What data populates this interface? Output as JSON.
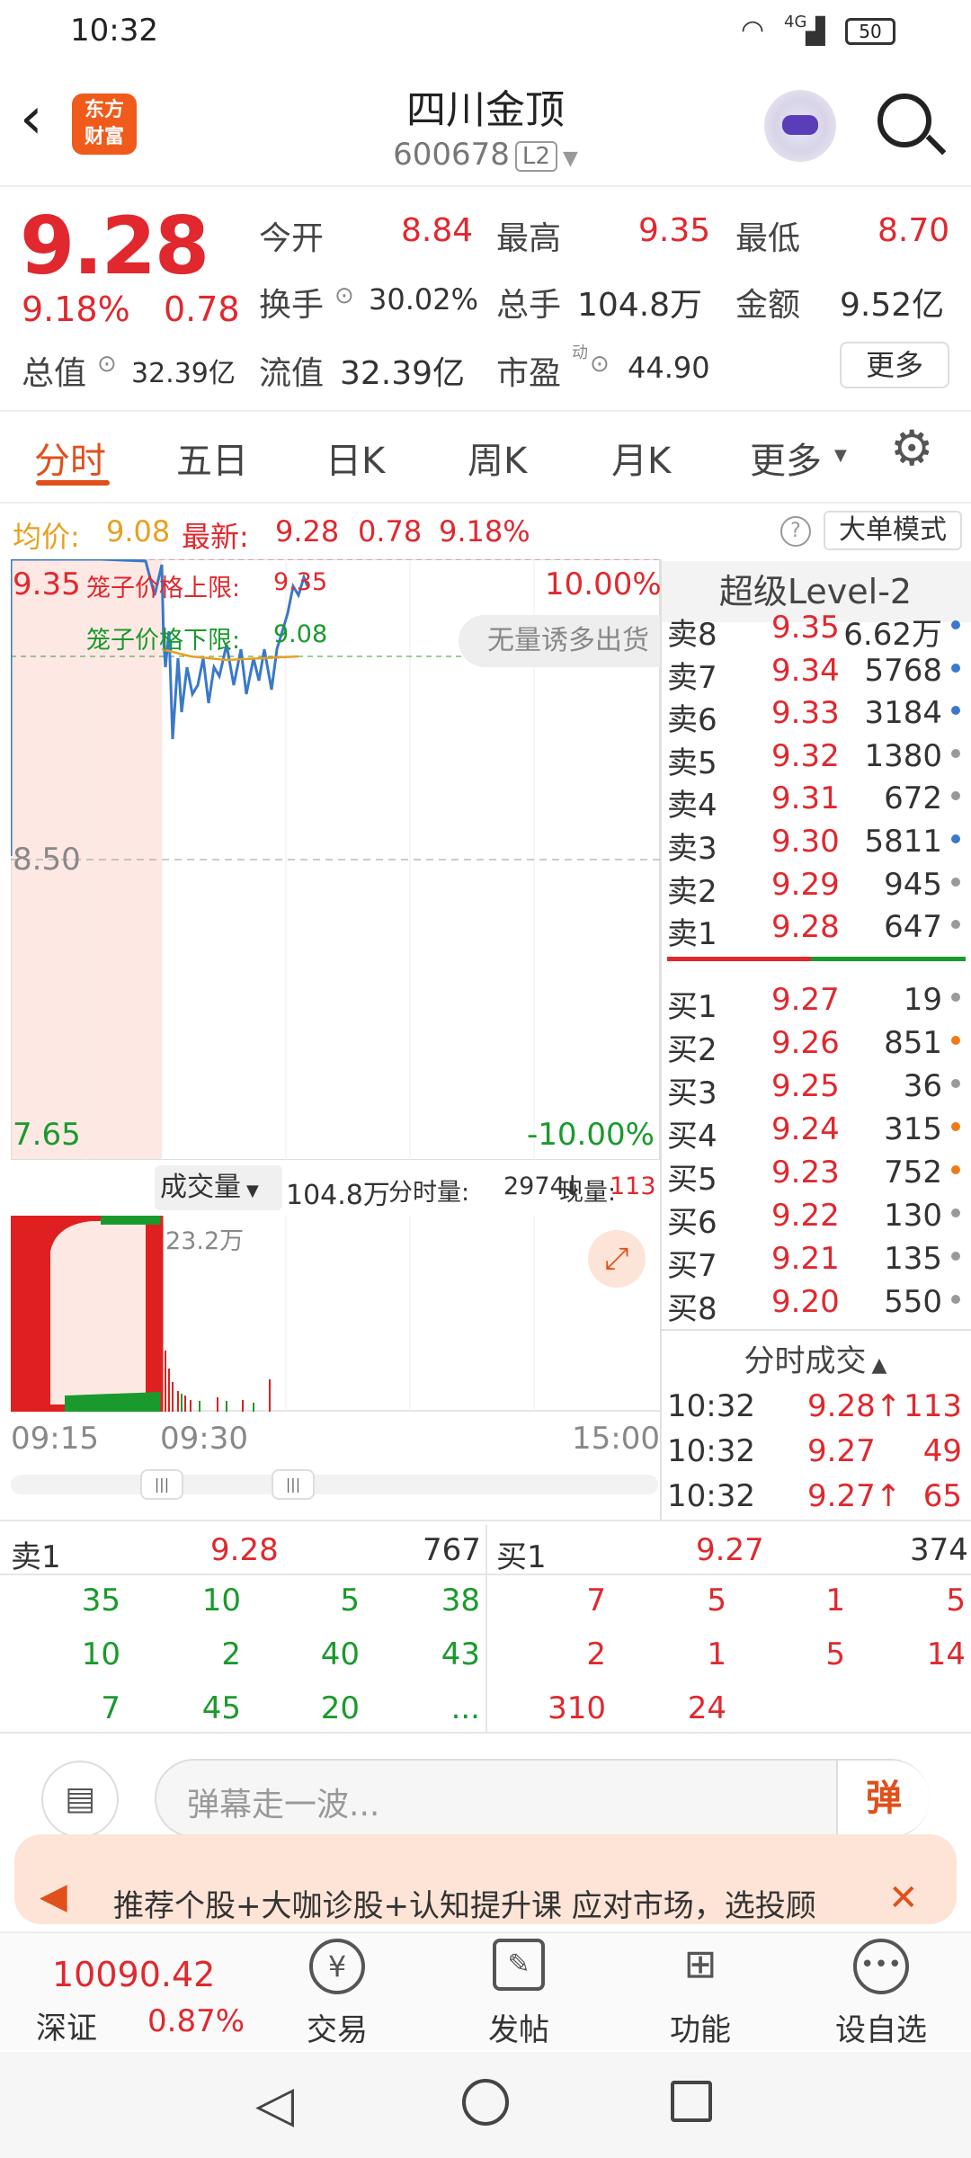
{
  "status_bar": {
    "time": "10:32",
    "signal": "4G",
    "battery": "50"
  },
  "header": {
    "logo_text_line1": "东方",
    "logo_text_line2": "财富",
    "title": "四川金顶",
    "code": "600678",
    "level_badge": "L2"
  },
  "quote": {
    "price": "9.28",
    "change_pct": "9.18%",
    "change": "0.78",
    "open_label": "今开",
    "open": "8.84",
    "high_label": "最高",
    "high": "9.35",
    "low_label": "最低",
    "low": "8.70",
    "turnover_label": "换手",
    "turnover": "30.02%",
    "volume_label": "总手",
    "volume": "104.8万",
    "amount_label": "金额",
    "amount": "9.52亿",
    "mktcap_label": "总值",
    "mktcap": "32.39亿",
    "float_label": "流值",
    "float": "32.39亿",
    "pe_label": "市盈",
    "pe_sup": "动",
    "pe": "44.90",
    "more_button": "更多"
  },
  "tabs": [
    {
      "label": "分时",
      "active": true
    },
    {
      "label": "五日"
    },
    {
      "label": "日K"
    },
    {
      "label": "周K"
    },
    {
      "label": "月K"
    },
    {
      "label": "更多"
    }
  ],
  "info_bar": {
    "avg_label": "均价:",
    "avg": "9.08",
    "latest_label": "最新:",
    "latest": "9.28",
    "latest_change": "0.78",
    "latest_pct": "9.18%",
    "big_order_mode": "大单模式"
  },
  "intraday_chart": {
    "y_top": "9.35",
    "y_mid": "8.50",
    "y_bottom": "7.65",
    "pct_top": "10.00%",
    "pct_bottom": "-10.00%",
    "cage_upper_label": "笼子价格上限:",
    "cage_upper": "9.35",
    "cage_lower_label": "笼子价格下限:",
    "cage_lower": "9.08",
    "toast": "无量诱多出货"
  },
  "volume_bar": {
    "label": "成交量",
    "total": "104.8万",
    "minute_label": "分时量:",
    "minute": "2974",
    "current_label": "现量:",
    "current": "113",
    "max_vol": "23.2万",
    "time_start": "09:15",
    "time_open": "09:30",
    "time_end": "15:00"
  },
  "level2_title": "超级Level-2",
  "order_book": {
    "asks": [
      {
        "label": "卖8",
        "price": "9.35",
        "vol": "6.62万",
        "dot": "#3a78c9"
      },
      {
        "label": "卖7",
        "price": "9.34",
        "vol": "5768",
        "dot": "#3a78c9"
      },
      {
        "label": "卖6",
        "price": "9.33",
        "vol": "3184",
        "dot": "#3a78c9"
      },
      {
        "label": "卖5",
        "price": "9.32",
        "vol": "1380",
        "dot": "#999999"
      },
      {
        "label": "卖4",
        "price": "9.31",
        "vol": "672",
        "dot": "#999999"
      },
      {
        "label": "卖3",
        "price": "9.30",
        "vol": "5811",
        "dot": "#3a78c9"
      },
      {
        "label": "卖2",
        "price": "9.29",
        "vol": "945",
        "dot": "#999999"
      },
      {
        "label": "卖1",
        "price": "9.28",
        "vol": "647",
        "dot": "#999999"
      }
    ],
    "bids": [
      {
        "label": "买1",
        "price": "9.27",
        "vol": "19",
        "dot": "#999999"
      },
      {
        "label": "买2",
        "price": "9.26",
        "vol": "851",
        "dot": "#f07b16"
      },
      {
        "label": "买3",
        "price": "9.25",
        "vol": "36",
        "dot": "#999999"
      },
      {
        "label": "买4",
        "price": "9.24",
        "vol": "315",
        "dot": "#f07b16"
      },
      {
        "label": "买5",
        "price": "9.23",
        "vol": "752",
        "dot": "#f07b16"
      },
      {
        "label": "买6",
        "price": "9.22",
        "vol": "130",
        "dot": "#999999"
      },
      {
        "label": "买7",
        "price": "9.21",
        "vol": "135",
        "dot": "#999999"
      },
      {
        "label": "买8",
        "price": "9.20",
        "vol": "550",
        "dot": "#999999"
      }
    ]
  },
  "trades": {
    "title": "分时成交",
    "rows": [
      {
        "time": "10:32",
        "price": "9.28",
        "arrow": "↑",
        "vol": "113"
      },
      {
        "time": "10:32",
        "price": "9.27",
        "arrow": "",
        "vol": "49"
      },
      {
        "time": "10:32",
        "price": "9.27",
        "arrow": "↑",
        "vol": "65"
      }
    ]
  },
  "queue": {
    "sell_label": "卖1",
    "sell_price": "9.28",
    "sell_total": "767",
    "buy_label": "买1",
    "buy_price": "9.27",
    "buy_total": "374",
    "sell_cells": [
      "35",
      "10",
      "5",
      "38",
      "10",
      "2",
      "40",
      "43",
      "7",
      "45",
      "20",
      "..."
    ],
    "buy_cells": [
      "7",
      "5",
      "1",
      "5",
      "2",
      "1",
      "5",
      "14",
      "310",
      "24"
    ]
  },
  "danmaku": {
    "placeholder": "弹幕走一波...",
    "send": "弹"
  },
  "banner": {
    "text": "推荐个股+大咖诊股+认知提升课 应对市场，选投顾"
  },
  "bottom_nav": {
    "index_value": "10090.42",
    "index_name": "深证",
    "index_pct": "0.87%",
    "items": [
      "交易",
      "发帖",
      "功能",
      "设自选"
    ]
  },
  "colors": {
    "up": "#e0282e",
    "down": "#1a9a2c",
    "accent": "#e0501a"
  }
}
